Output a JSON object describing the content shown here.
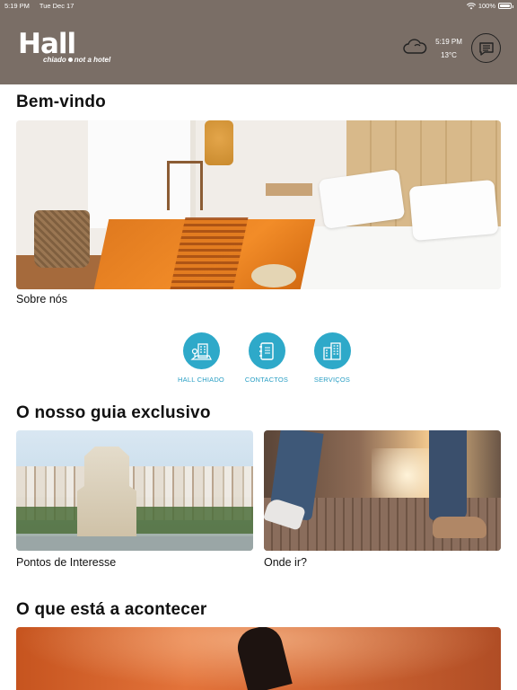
{
  "status_bar": {
    "time": "5:19 PM",
    "date": "Tue Dec 17",
    "battery": "100%"
  },
  "header": {
    "logo_main": "Hall",
    "logo_sub_1": "chiado",
    "logo_sub_2": "not a hotel",
    "clock": "5:19 PM",
    "temperature": "13°C",
    "weather_icon": "cloud-icon",
    "menu_icon": "chat-list-icon",
    "background_color": "#7a6e66"
  },
  "welcome": {
    "title": "Bem-vindo",
    "caption": "Sobre nós"
  },
  "quick_links": [
    {
      "label": "HALL CHIADO",
      "icon": "building-map-icon"
    },
    {
      "label": "CONTACTOS",
      "icon": "address-book-icon"
    },
    {
      "label": "SERVIÇOS",
      "icon": "buildings-icon"
    }
  ],
  "guide": {
    "title": "O nosso guia exclusivo",
    "cards": [
      {
        "caption": "Pontos de Interesse"
      },
      {
        "caption": "Onde ir?"
      }
    ]
  },
  "events": {
    "title": "O que está a acontecer"
  },
  "accent_color": "#2ea9c9"
}
